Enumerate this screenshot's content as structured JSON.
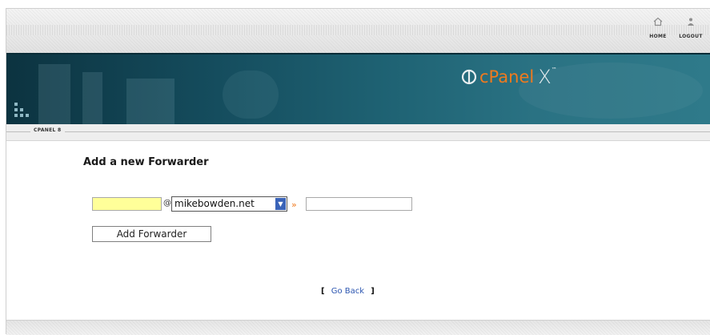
{
  "toplinks": [
    {
      "label": "HOME",
      "icon": "home-icon"
    },
    {
      "label": "LOGOUT",
      "icon": "logout-icon"
    }
  ],
  "banner": {
    "logo_text": "cPanel",
    "logo_x": "X",
    "logo_tm": "™"
  },
  "breadcrumb": "CPANEL 8",
  "form": {
    "heading": "Add a new Forwarder",
    "user_value": "",
    "at_sign": "@",
    "domain_selected": "mikebowden.net",
    "arrow_glyph": "»",
    "destination_value": "",
    "submit_label": "Add Forwarder"
  },
  "goback": {
    "open": "[",
    "label": "Go Back",
    "close": "]"
  },
  "colors": {
    "accent": "#f07a1e",
    "banner": "#1f6374",
    "input_highlight": "#ffff99"
  }
}
